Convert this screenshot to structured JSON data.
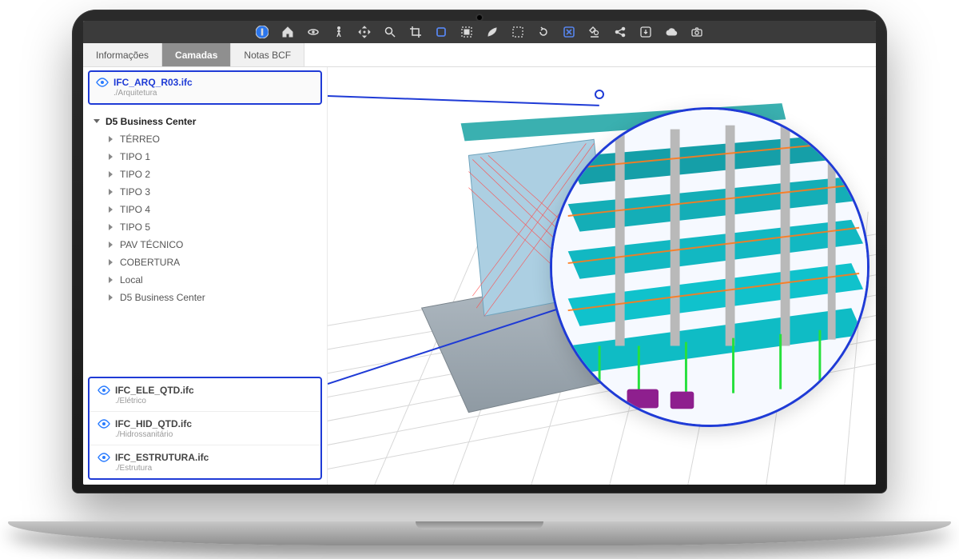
{
  "toolbar_icons": [
    "info",
    "home",
    "orbit",
    "walk",
    "pan",
    "search",
    "crop",
    "cube",
    "select",
    "leaf",
    "select-similar",
    "redo",
    "x-box",
    "microscope",
    "share",
    "download",
    "cloud",
    "camera"
  ],
  "tabs": [
    {
      "label": "Informações",
      "active": false
    },
    {
      "label": "Camadas",
      "active": true
    },
    {
      "label": "Notas BCF",
      "active": false
    }
  ],
  "active_layer": {
    "name": "IFC_ARQ_R03.ifc",
    "path": "./Arquitetura"
  },
  "tree": {
    "root": "D5 Business Center",
    "children": [
      "TÉRREO",
      "TIPO 1",
      "TIPO 2",
      "TIPO 3",
      "TIPO 4",
      "TIPO 5",
      "PAV TÉCNICO",
      "COBERTURA",
      "Local",
      "D5 Business Center"
    ]
  },
  "other_layers": [
    {
      "name": "IFC_ELE_QTD.ifc",
      "path": "./Elétrico"
    },
    {
      "name": "IFC_HID_QTD.ifc",
      "path": "./Hidrossanitário"
    },
    {
      "name": "IFC_ESTRUTURA.ifc",
      "path": "./Estrutura"
    }
  ]
}
